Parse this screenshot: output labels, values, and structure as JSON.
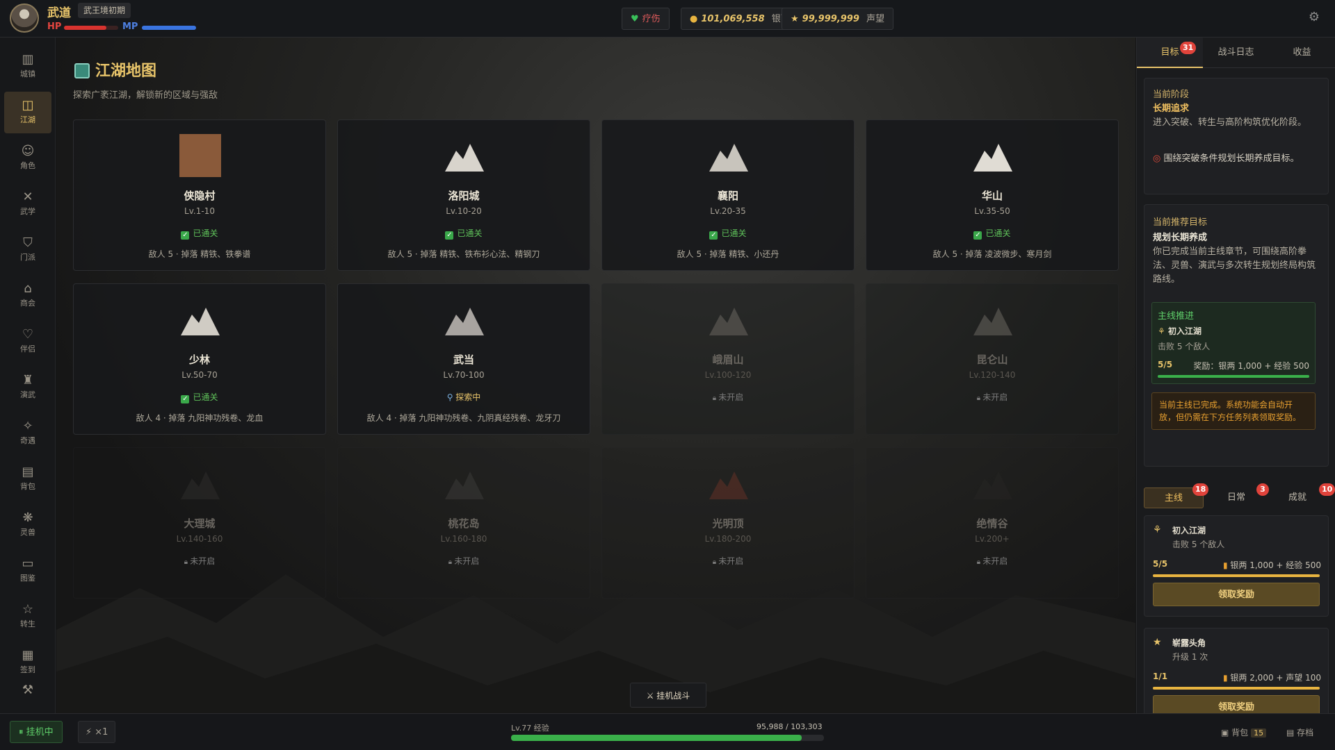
{
  "player": {
    "name": "武道",
    "realm": "武王境初期",
    "hp_label": "HP",
    "mp_label": "MP",
    "hp_fraction": 0.78,
    "mp_fraction": 1.0
  },
  "topbar": {
    "status_label": "疗伤",
    "silver_value": "101,069,558",
    "silver_unit": "银两",
    "fame_value": "99,999,999",
    "fame_unit": "声望"
  },
  "sidebar": {
    "items": [
      {
        "label": "城镇",
        "icon": "town-icon"
      },
      {
        "label": "江湖",
        "icon": "map-icon"
      },
      {
        "label": "角色",
        "icon": "character-icon"
      },
      {
        "label": "武学",
        "icon": "martial-arts-icon"
      },
      {
        "label": "门派",
        "icon": "sect-icon"
      },
      {
        "label": "商会",
        "icon": "shop-icon"
      },
      {
        "label": "伴侣",
        "icon": "heart-icon"
      },
      {
        "label": "演武",
        "icon": "trophy-icon"
      },
      {
        "label": "奇遇",
        "icon": "sparkle-icon"
      },
      {
        "label": "背包",
        "icon": "backpack-icon"
      },
      {
        "label": "灵兽",
        "icon": "paw-icon"
      },
      {
        "label": "图鉴",
        "icon": "book-icon"
      },
      {
        "label": "转生",
        "icon": "star-icon"
      },
      {
        "label": "签到",
        "icon": "calendar-icon"
      }
    ]
  },
  "page": {
    "title": "江湖地图",
    "subtitle": "探索广袤江湖，解锁新的区域与强敌"
  },
  "regions": [
    {
      "name": "侠隐村",
      "level": "Lv.1-10",
      "status": "已通关",
      "desc": "敌人 5 · 掉落 精铁、铁拳谱"
    },
    {
      "name": "洛阳城",
      "level": "Lv.10-20",
      "status": "已通关",
      "desc": "敌人 5 · 掉落 精铁、铁布衫心法、精钢刀"
    },
    {
      "name": "襄阳",
      "level": "Lv.20-35",
      "status": "已通关",
      "desc": "敌人 5 · 掉落 精铁、小还丹"
    },
    {
      "name": "华山",
      "level": "Lv.35-50",
      "status": "已通关",
      "desc": "敌人 5 · 掉落 凌波微步、寒月剑"
    },
    {
      "name": "少林",
      "level": "Lv.50-70",
      "status": "已通关",
      "desc": "敌人 4 · 掉落 九阳神功残卷、龙血"
    },
    {
      "name": "武当",
      "level": "Lv.70-100",
      "status": "探索中",
      "desc": "敌人 4 · 掉落 九阳神功残卷、九阴真经残卷、龙牙刀"
    },
    {
      "name": "峨眉山",
      "level": "Lv.100-120",
      "status": "未开启",
      "desc": ""
    },
    {
      "name": "昆仑山",
      "level": "Lv.120-140",
      "status": "未开启",
      "desc": ""
    },
    {
      "name": "大理城",
      "level": "Lv.140-160",
      "status": "未开启",
      "desc": ""
    },
    {
      "name": "桃花岛",
      "level": "Lv.160-180",
      "status": "未开启",
      "desc": ""
    },
    {
      "name": "光明顶",
      "level": "Lv.180-200",
      "status": "未开启",
      "desc": ""
    },
    {
      "name": "绝情谷",
      "level": "Lv.200+",
      "status": "未开启",
      "desc": ""
    }
  ],
  "auto_battle_label": "挂机战斗",
  "right_panel": {
    "tabs": [
      {
        "label": "目标",
        "badge": "31"
      },
      {
        "label": "战斗日志",
        "badge": ""
      },
      {
        "label": "收益",
        "badge": ""
      }
    ],
    "stage_header": "当前阶段",
    "stage_name": "长期追求",
    "stage_desc": "进入突破、转生与高阶构筑优化阶段。",
    "stage_tip": "围绕突破条件规划长期养成目标。",
    "rec_header": "当前推荐目标",
    "rec_title": "规划长期养成",
    "rec_desc": "你已完成当前主线章节，可围绕高阶拳法、灵兽、演武与多次转生规划终局构筑路线。",
    "main_progress": {
      "header": "主线推进",
      "quest": "初入江湖",
      "task": "击败 5 个敌人",
      "progress": "5/5",
      "reward": "奖励：银两 1,000 + 经验 500",
      "fraction": 1.0
    },
    "notice": "当前主线已完成。系统功能会自动开放，但仍需在下方任务列表领取奖励。",
    "quest_tabs": [
      {
        "label": "主线",
        "badge": "18"
      },
      {
        "label": "日常",
        "badge": "3"
      },
      {
        "label": "成就",
        "badge": "10"
      }
    ],
    "quests": [
      {
        "name": "初入江湖",
        "task": "击败 5 个敌人",
        "progress": "5/5",
        "reward": "银两 1,000 + 经验 500",
        "fraction": 1.0,
        "button": "领取奖励"
      },
      {
        "name": "崭露头角",
        "task": "升级 1 次",
        "progress": "1/1",
        "reward": "银两 2,000 + 声望 100",
        "fraction": 1.0,
        "button": "领取奖励"
      }
    ]
  },
  "bottombar": {
    "idle_label": "挂机中",
    "speed_label": "×1",
    "xp_label": "Lv.77 经验",
    "xp_value": "95,988 / 103,303",
    "xp_fraction": 0.929,
    "bag_label": "背包",
    "bag_count": "15",
    "save_label": "存档"
  },
  "colors": {
    "accent": "#e8c46a",
    "hp": "#d8332f",
    "mp": "#3a74e0",
    "cleared": "#5fc25a",
    "xp": "#3ab04a"
  }
}
